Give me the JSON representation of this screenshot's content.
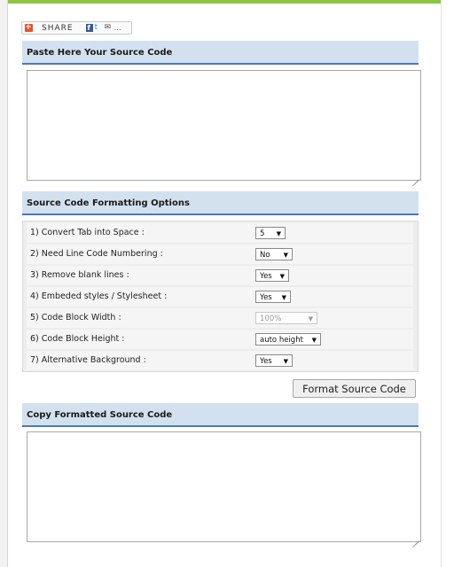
{
  "share": {
    "label": "SHARE",
    "more": "…",
    "plus_icon": "+",
    "facebook_icon": "f",
    "twitter_icon": "t",
    "mail_icon": "✉"
  },
  "source": {
    "header": "Paste Here Your Source Code",
    "value": ""
  },
  "options": {
    "header": "Source Code Formatting Options",
    "rows": [
      {
        "label": "1) Convert Tab into Space :",
        "value": "5",
        "enabled": true
      },
      {
        "label": "2) Need Line Code Numbering :",
        "value": "No",
        "enabled": true
      },
      {
        "label": "3) Remove blank lines :",
        "value": "Yes",
        "enabled": true
      },
      {
        "label": "4) Embeded styles / Stylesheet :",
        "value": "Yes",
        "enabled": true
      },
      {
        "label": "5) Code Block Width :",
        "value": "100%",
        "enabled": false
      },
      {
        "label": "6) Code Block Height :",
        "value": "auto height",
        "enabled": true
      },
      {
        "label": "7) Alternative Background :",
        "value": "Yes",
        "enabled": true
      }
    ]
  },
  "format_button": {
    "label": "Format Source Code"
  },
  "output": {
    "header": "Copy Formatted Source Code",
    "value": ""
  },
  "colors": {
    "accent": "#4a79b6",
    "header_bg": "#d3e1ef",
    "top_bar": "#8dc63f"
  }
}
